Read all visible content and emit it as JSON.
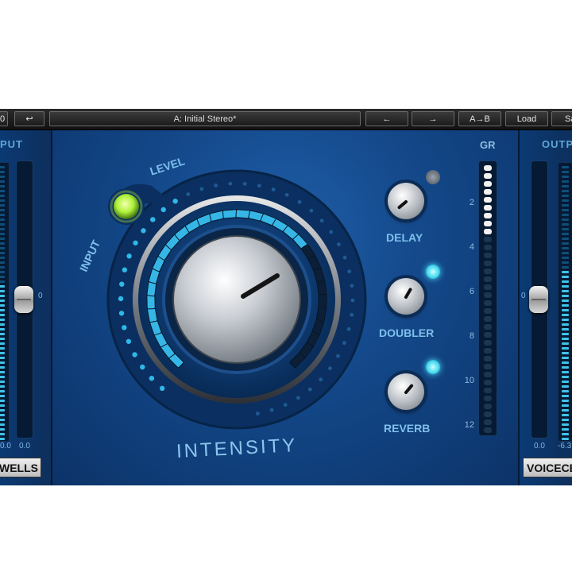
{
  "toolbar": {
    "left_btn_1": "0",
    "left_btn_2": "↩",
    "preset": "A: Initial Stereo*",
    "prev": "←",
    "next": "→",
    "ab": "A→B",
    "load": "Load",
    "save": "Sa"
  },
  "input_panel": {
    "title": "PUT",
    "fader_zero": "0",
    "val_left": "0.0",
    "val_right": "0.0",
    "fader_level": 0.5
  },
  "output_panel": {
    "title": "OUTP",
    "fader_zero": "0",
    "val_left": "0.0",
    "val_right": "-6.3",
    "fader_level": 0.5
  },
  "main": {
    "level_label": "LEVEL",
    "input_label": "INPUT",
    "intensity_label": "INTENSITY",
    "delay_label": "DELAY",
    "doubler_label": "DOUBLER",
    "reverb_label": "REVERB",
    "gr_label": "GR",
    "gr_ticks": [
      "2",
      "4",
      "6",
      "8",
      "10",
      "12"
    ]
  },
  "logos": {
    "left": "WELLS",
    "right": "VOICECE"
  },
  "colors": {
    "accent": "#3fc3e8",
    "panel": "#134788",
    "led_green": "#aef23a"
  },
  "icons": {
    "prev": "arrow-left-icon",
    "next": "arrow-right-icon",
    "input_led": "green-led-icon"
  }
}
